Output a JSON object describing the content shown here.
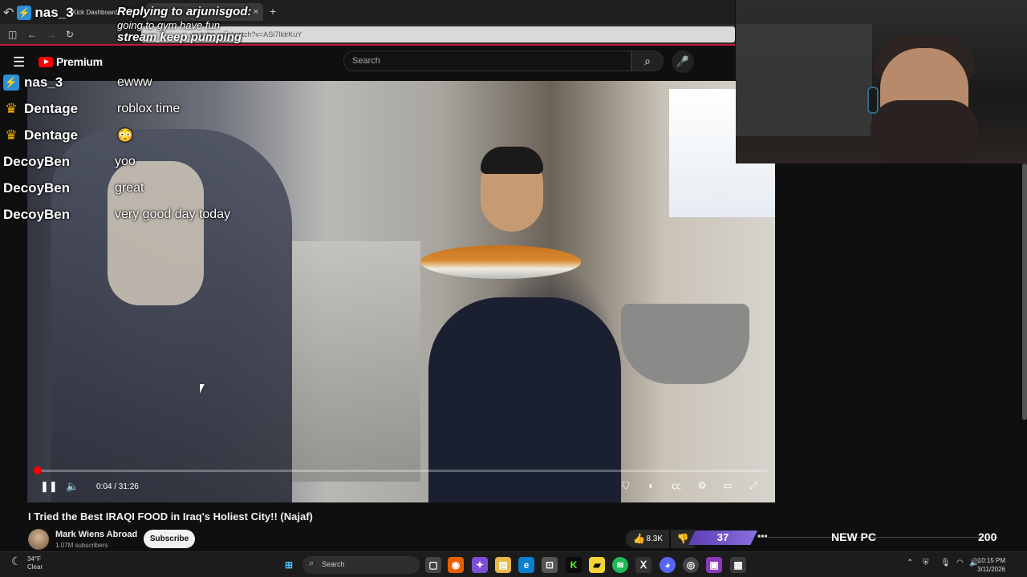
{
  "browser": {
    "tab_label": "Kick Dashboard",
    "tab_active_label": "",
    "new_tab": "+",
    "close": "×",
    "url": "youtube.com/watch?v=ASi7lldrKuY"
  },
  "youtube": {
    "logo_text": "Premium",
    "search_placeholder": "Search"
  },
  "video": {
    "current_time": "0:04",
    "duration": "31:26",
    "time_text": "0:04 / 31:26",
    "progress_fraction": 0.002,
    "title": "I Tried the Best IRAQI FOOD in Iraq's Holiest City!! (Najaf)",
    "channel": "Mark Wiens Abroad",
    "subscribers": "1.07M subscribers",
    "subscribe_label": "Subscribe",
    "likes": "8.3K"
  },
  "reply_overlay": {
    "user": "nas_3",
    "line1": "Replying to arjunisgod:",
    "line2": "going to gym have fun",
    "line3": "stream   keep pumping"
  },
  "chat": [
    {
      "user": "nas_3",
      "badge": "kick",
      "message": "ewww"
    },
    {
      "user": "Dentage",
      "badge": "crown",
      "message": "roblox time"
    },
    {
      "user": "Dentage",
      "badge": "crown",
      "message": "😳"
    },
    {
      "user": "DecoyBen",
      "badge": "",
      "message": "yoo"
    },
    {
      "user": "DecoyBen",
      "badge": "",
      "message": "great"
    },
    {
      "user": "DecoyBen",
      "badge": "",
      "message": "very good day today"
    }
  ],
  "stream_bar": {
    "count": "37",
    "goal_label": "NEW PC",
    "goal_value": "200"
  },
  "taskbar": {
    "temp": "34°F",
    "weather": "Clear",
    "search": "Search",
    "time": "10:15 PM",
    "date": "3/11/2026"
  },
  "colors": {
    "accent_red": "#ff0000",
    "kick_green": "#53fc18",
    "purple": "#6b4fcf"
  }
}
